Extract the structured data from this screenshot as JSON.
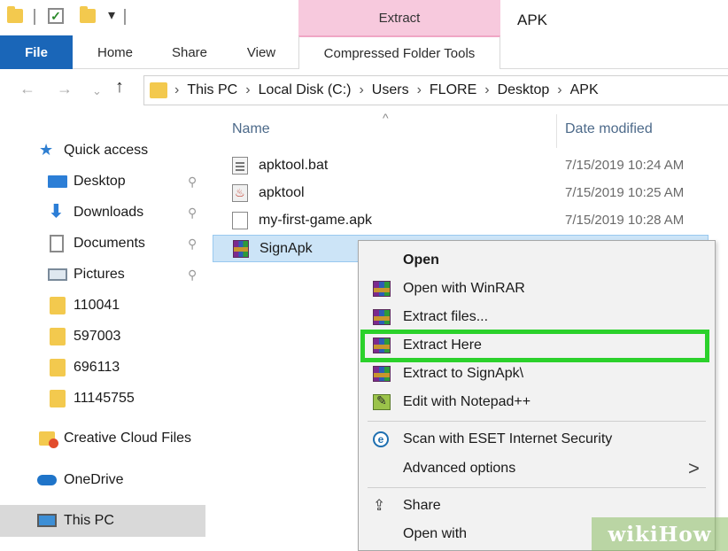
{
  "window": {
    "title": "APK"
  },
  "ribbon": {
    "context_group": "Extract",
    "tabs": [
      "File",
      "Home",
      "Share",
      "View",
      "Compressed Folder Tools"
    ],
    "active_tab": "File",
    "colors": {
      "file_tab": "#1a66b8",
      "context_tab": "#f7c9dd"
    }
  },
  "quick_access_toolbar": {
    "dropdown": "▾"
  },
  "address_bar": {
    "back_icon": "←",
    "forward_icon": "→",
    "recent_icon": "⌄",
    "up_icon": "↑",
    "path": [
      "This PC",
      "Local Disk (C:)",
      "Users",
      "FLORE",
      "Desktop",
      "APK"
    ],
    "separator": "›"
  },
  "sidebar": {
    "items": [
      {
        "label": "Quick access",
        "icon": "star-icon",
        "pinned": false
      },
      {
        "label": "Desktop",
        "icon": "desktop-icon",
        "pinned": true
      },
      {
        "label": "Downloads",
        "icon": "download-icon",
        "pinned": true
      },
      {
        "label": "Documents",
        "icon": "document-icon",
        "pinned": true
      },
      {
        "label": "Pictures",
        "icon": "pictures-icon",
        "pinned": true
      },
      {
        "label": "110041",
        "icon": "folder-icon",
        "pinned": false
      },
      {
        "label": "597003",
        "icon": "folder-icon",
        "pinned": false
      },
      {
        "label": "696113",
        "icon": "folder-icon",
        "pinned": false
      },
      {
        "label": "11145755",
        "icon": "folder-icon",
        "pinned": false
      },
      {
        "label": "Creative Cloud Files",
        "icon": "creative-cloud-icon",
        "pinned": false
      },
      {
        "label": "OneDrive",
        "icon": "onedrive-icon",
        "pinned": false
      },
      {
        "label": "This PC",
        "icon": "this-pc-icon",
        "pinned": false,
        "selected": true
      }
    ],
    "pin_glyph": "📌"
  },
  "file_list": {
    "sort_indicator": "^",
    "columns": [
      "Name",
      "Date modified"
    ],
    "rows": [
      {
        "name": "apktool.bat",
        "date": "7/15/2019 10:24 AM",
        "icon": "batch-file-icon"
      },
      {
        "name": "apktool",
        "date": "7/15/2019 10:25 AM",
        "icon": "java-jar-icon"
      },
      {
        "name": "my-first-game.apk",
        "date": "7/15/2019 10:28 AM",
        "icon": "apk-file-icon"
      },
      {
        "name": "SignApk",
        "date": "",
        "icon": "winrar-archive-icon",
        "selected": true
      }
    ]
  },
  "context_menu": {
    "items": [
      {
        "label": "Open",
        "icon": "",
        "bold": true
      },
      {
        "label": "Open with WinRAR",
        "icon": "winrar-icon"
      },
      {
        "label": "Extract files...",
        "icon": "winrar-icon"
      },
      {
        "label": "Extract Here",
        "icon": "winrar-icon",
        "highlighted": true
      },
      {
        "label": "Extract to SignApk\\",
        "icon": "winrar-icon"
      },
      {
        "label": "Edit with Notepad++",
        "icon": "notepad-plus-plus-icon"
      },
      {
        "label": "Scan with ESET Internet Security",
        "icon": "eset-icon"
      },
      {
        "label": "Advanced options",
        "icon": "",
        "submenu": true
      },
      {
        "label": "Share",
        "icon": "share-icon"
      },
      {
        "label": "Open with",
        "icon": ""
      }
    ],
    "submenu_arrow": ">",
    "highlight_color": "#2bd12b"
  },
  "watermark": {
    "part1": "wiki",
    "part2": "How"
  }
}
